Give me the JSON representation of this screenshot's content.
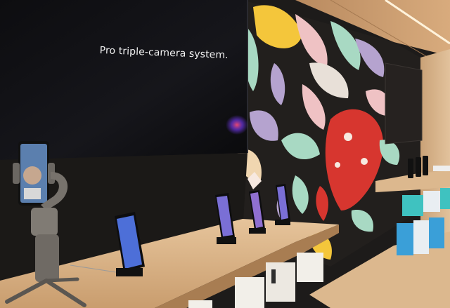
{
  "scene": {
    "tv_caption": "Pro triple-camera system.",
    "phone_screen_text": "",
    "side_screen_text": "",
    "colors": {
      "wall_dark": "#1d1b1a",
      "tv_screen": "#121216",
      "shelf_wood": "#d9b48a",
      "mural_base": "#221f1d",
      "mural_red": "#d7362f",
      "mural_pink": "#efc2c4",
      "mural_mint": "#a8d9c3",
      "mural_lavender": "#b5a3cf",
      "mural_yellow": "#f4c63b",
      "ceiling": "#c99a6d"
    }
  }
}
